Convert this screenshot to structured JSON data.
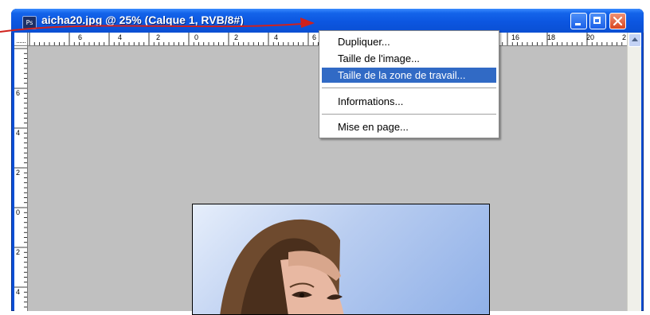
{
  "window": {
    "title": "aicha20.jpg @ 25% (Calque 1, RVB/8#)",
    "app_icon_text": "Ps",
    "frame_color": "#0b4fd6",
    "close_color": "#d9461f"
  },
  "rulers": {
    "horizontal_labels": [
      "6",
      "4",
      "2",
      "0",
      "2",
      "4",
      "6",
      "16",
      "18",
      "20",
      "2"
    ],
    "vertical_labels": [
      "6",
      "4",
      "2",
      "0",
      "2",
      "4"
    ]
  },
  "context_menu": {
    "items": [
      {
        "label": "Dupliquer..."
      },
      {
        "label": "Taille de l'image..."
      },
      {
        "label": "Taille de la zone de travail..."
      },
      {
        "label": "Informations..."
      },
      {
        "label": "Mise en page..."
      }
    ],
    "selected_index": 2,
    "highlight_color": "#316ac5"
  },
  "annotation": {
    "arrow_color": "#d0211c"
  },
  "colors": {
    "workspace": "#c0c0c0"
  }
}
